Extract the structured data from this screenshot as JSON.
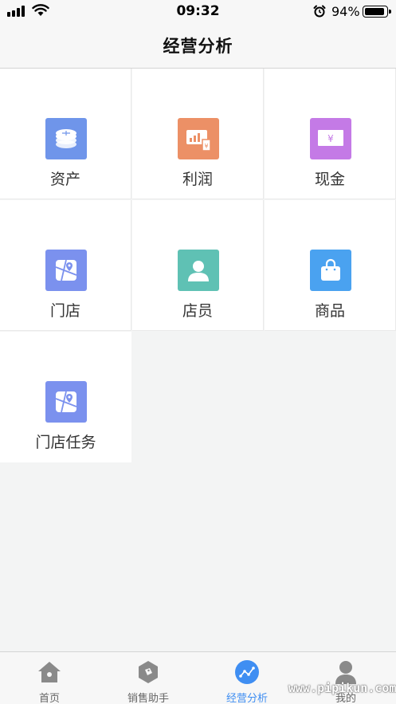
{
  "status_bar": {
    "time": "09:32",
    "battery_percent": "94%",
    "battery_level": 0.94,
    "icons": [
      "signal-icon",
      "wifi-icon",
      "alarm-icon",
      "battery-icon"
    ]
  },
  "header": {
    "title": "经营分析"
  },
  "grid": {
    "items": [
      {
        "label": "资产",
        "icon": "coins-icon",
        "color": "#6f95ea"
      },
      {
        "label": "利润",
        "icon": "profit-chart-icon",
        "color": "#ec9066"
      },
      {
        "label": "现金",
        "icon": "cash-icon",
        "color": "#c47ae6"
      },
      {
        "label": "门店",
        "icon": "store-map-icon",
        "color": "#7b91ee"
      },
      {
        "label": "店员",
        "icon": "staff-person-icon",
        "color": "#5fc1b4"
      },
      {
        "label": "商品",
        "icon": "shopping-bag-icon",
        "color": "#4aa2f0"
      },
      {
        "label": "门店任务",
        "icon": "store-task-map-icon",
        "color": "#7b91ee"
      }
    ]
  },
  "tab_bar": {
    "tabs": [
      {
        "label": "首页",
        "icon": "home-icon",
        "active": false
      },
      {
        "label": "销售助手",
        "icon": "tag-icon",
        "active": false
      },
      {
        "label": "经营分析",
        "icon": "analysis-icon",
        "active": true
      },
      {
        "label": "我的",
        "icon": "user-icon",
        "active": false
      }
    ],
    "active_color": "#3f8ef2",
    "inactive_color": "#8a8a8a"
  },
  "watermark": "www.pipikun.com"
}
